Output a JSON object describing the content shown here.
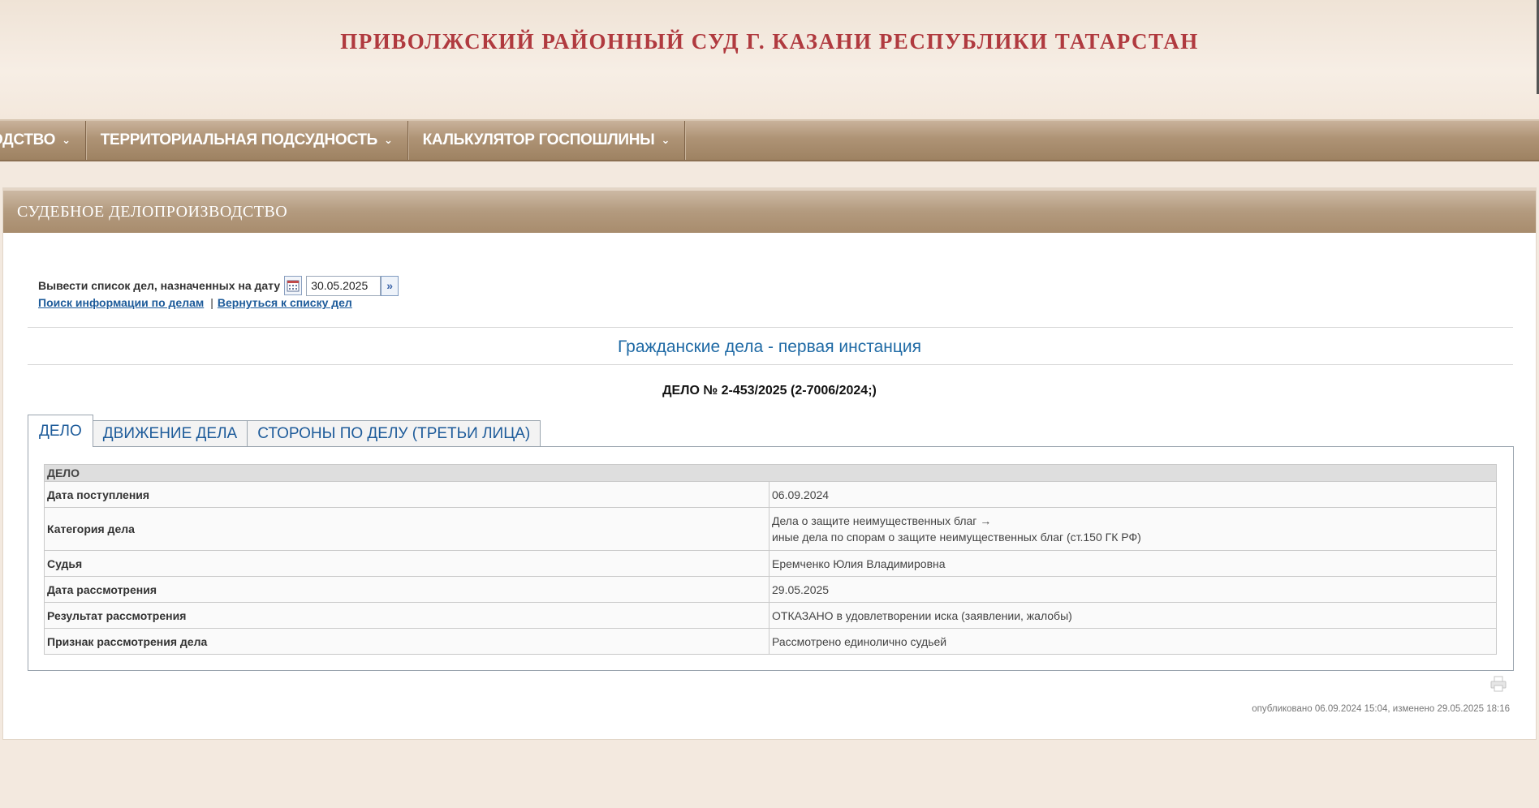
{
  "header": {
    "title": "ПРИВОЛЖСКИЙ РАЙОННЫЙ СУД Г. КАЗАНИ РЕСПУБЛИКИ ТАТАРСТАН"
  },
  "nav": {
    "items": [
      {
        "label": "ВОДСТВО",
        "icon": "chevron-down-icon"
      },
      {
        "label": "ТЕРРИТОРИАЛЬНАЯ ПОДСУДНОСТЬ",
        "icon": "chevron-down-icon"
      },
      {
        "label": "КАЛЬКУЛЯТОР ГОСПОШЛИНЫ",
        "icon": "chevron-down-icon"
      }
    ],
    "chevron": "⌄"
  },
  "panel": {
    "title": "СУДЕБНОЕ ДЕЛОПРОИЗВОДСТВО"
  },
  "date_filter": {
    "label": "Вывести список дел, назначенных на дату",
    "value": "30.05.2025",
    "calendar_icon": "calendar-icon",
    "go_icon": "double-chevron-right-icon",
    "go_glyph": "»"
  },
  "links": {
    "search": "Поиск информации по делам",
    "separator": "|",
    "back": "Вернуться к списку дел"
  },
  "section": {
    "title": "Гражданские дела - первая инстанция"
  },
  "case": {
    "number": "ДЕЛО № 2-453/2025 (2-7006/2024;)"
  },
  "tabs": [
    {
      "label": "ДЕЛО",
      "active": true
    },
    {
      "label": "ДВИЖЕНИЕ ДЕЛА",
      "active": false
    },
    {
      "label": "СТОРОНЫ ПО ДЕЛУ (ТРЕТЬИ ЛИЦА)",
      "active": false
    }
  ],
  "case_table": {
    "header": "ДЕЛО",
    "rows": [
      {
        "key": "Дата поступления",
        "value": "06.09.2024"
      },
      {
        "key": "Категория дела",
        "value": "Дела о защите неимущественных благ →",
        "value2": "иные дела по спорам о защите неимущественных благ (ст.150 ГК РФ)"
      },
      {
        "key": "Судья",
        "value": "Еремченко Юлия Владимировна"
      },
      {
        "key": "Дата рассмотрения",
        "value": "29.05.2025"
      },
      {
        "key": "Результат рассмотрения",
        "value": "ОТКАЗАНО в удовлетворении иска (заявлении, жалобы)"
      },
      {
        "key": "Признак рассмотрения дела",
        "value": "Рассмотрено единолично судьей"
      }
    ]
  },
  "footer": {
    "print_icon": "printer-icon",
    "published": "опубликовано 06.09.2024 15:04, изменено 29.05.2025 18:16"
  },
  "colors": {
    "title_red": "#b03a3f",
    "nav_brown": "#ae9375",
    "link_blue": "#1d5b9a",
    "section_blue": "#1f6aa5"
  }
}
